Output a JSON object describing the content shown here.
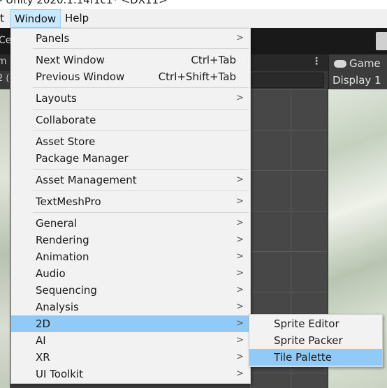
{
  "title_bar": {
    "text": "- Unity 2020.1.14f1c1* <DX11>"
  },
  "menubar": {
    "edit_partial": "t",
    "window": "Window",
    "help": "Help"
  },
  "editor": {
    "top_partial": "Ce",
    "scene_tab_partial": "m",
    "scene_toolbar_partial": "2 (",
    "game_tab": "Game",
    "display": "Display 1"
  },
  "window_menu": {
    "items": [
      {
        "label": "Panels",
        "submenu": true
      },
      {
        "label": "Next Window",
        "shortcut": "Ctrl+Tab"
      },
      {
        "label": "Previous Window",
        "shortcut": "Ctrl+Shift+Tab"
      },
      {
        "label": "Layouts",
        "submenu": true
      },
      {
        "label": "Collaborate"
      },
      {
        "label": "Asset Store"
      },
      {
        "label": "Package Manager"
      },
      {
        "label": "Asset Management",
        "submenu": true
      },
      {
        "label": "TextMeshPro",
        "submenu": true
      },
      {
        "label": "General",
        "submenu": true
      },
      {
        "label": "Rendering",
        "submenu": true
      },
      {
        "label": "Animation",
        "submenu": true
      },
      {
        "label": "Audio",
        "submenu": true
      },
      {
        "label": "Sequencing",
        "submenu": true
      },
      {
        "label": "Analysis",
        "submenu": true
      },
      {
        "label": "2D",
        "submenu": true,
        "highlighted": true
      },
      {
        "label": "AI",
        "submenu": true
      },
      {
        "label": "XR",
        "submenu": true
      },
      {
        "label": "UI Toolkit",
        "submenu": true
      }
    ],
    "arrow_glyph": ">"
  },
  "submenu_2d": {
    "items": [
      {
        "label": "Sprite Editor"
      },
      {
        "label": "Sprite Packer"
      },
      {
        "label": "Tile Palette",
        "highlighted": true
      }
    ]
  },
  "colors": {
    "highlight": "#91c9f7",
    "menu_bg": "#f2f2f2",
    "window_menu_active": "#cce8ff"
  }
}
